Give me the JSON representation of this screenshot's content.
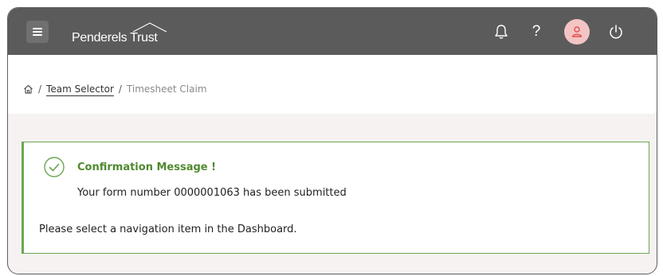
{
  "header": {
    "logo_text": "Penderels Trust",
    "icons": [
      "menu-icon",
      "bell-icon",
      "help-icon",
      "user-icon",
      "power-icon"
    ],
    "help_glyph": "?",
    "colors": {
      "bar": "#5b5b5b",
      "avatar_bg": "#f4c4c4",
      "avatar_icon": "#e05050"
    }
  },
  "breadcrumb": {
    "home_icon": "home-icon",
    "separator": "/",
    "items": [
      "Team Selector",
      "Timesheet Claim"
    ]
  },
  "confirmation": {
    "title": "Confirmation Message !",
    "message": "Your form number 0000001063 has been submitted",
    "note": "Please select a navigation item in the Dashboard.",
    "icon": "check-circle-icon",
    "accent": "#6aa84f"
  }
}
